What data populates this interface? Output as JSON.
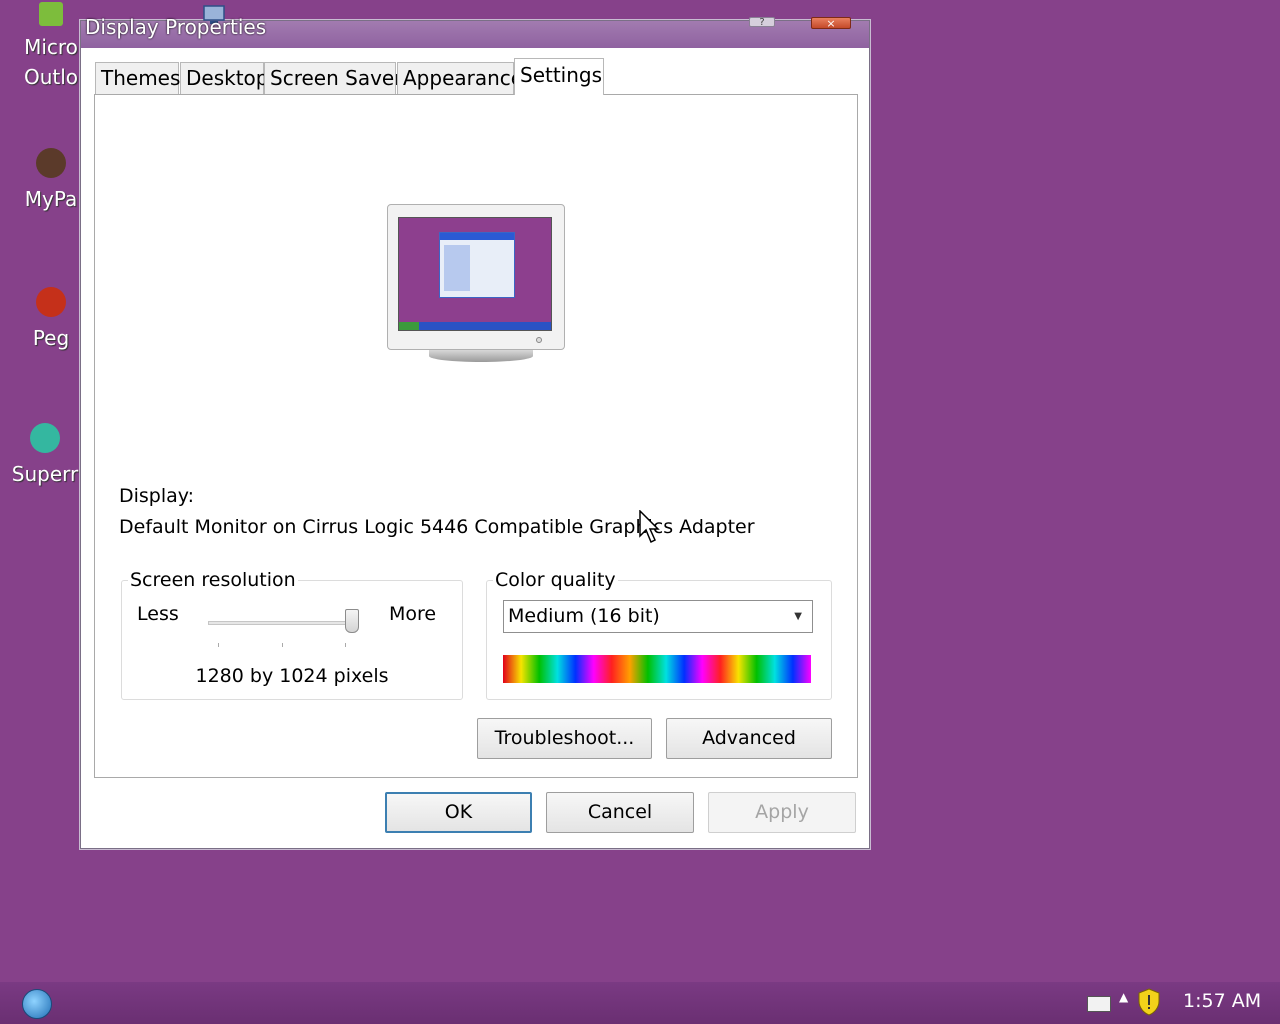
{
  "desktop": {
    "icons": [
      {
        "label": "Micro\nOutlo"
      },
      {
        "label": "MyPa"
      },
      {
        "label": "Peg"
      },
      {
        "label": "Superr"
      }
    ]
  },
  "window": {
    "title": "Display Properties",
    "help_label": "?",
    "close_label": "×"
  },
  "tabs": [
    {
      "label": "Themes"
    },
    {
      "label": "Desktop"
    },
    {
      "label": "Screen Saver"
    },
    {
      "label": "Appearance"
    },
    {
      "label": "Settings",
      "active": true
    }
  ],
  "settings": {
    "display_label": "Display:",
    "display_value": "Default Monitor on Cirrus Logic 5446 Compatible Graphics Adapter",
    "resolution": {
      "group_title": "Screen resolution",
      "less_label": "Less",
      "more_label": "More",
      "value_text": "1280 by 1024 pixels",
      "slider_position": 1.0
    },
    "color_quality": {
      "group_title": "Color quality",
      "selected": "Medium (16 bit)"
    },
    "troubleshoot_label": "Troubleshoot...",
    "advanced_label": "Advanced"
  },
  "footer": {
    "ok_label": "OK",
    "cancel_label": "Cancel",
    "apply_label": "Apply"
  },
  "taskbar": {
    "clock": "1:57 AM"
  },
  "colors": {
    "desktop_background": "#86418a",
    "title_bar": "#8f62a0",
    "default_button_border": "#3c7fb1"
  },
  "icons": [
    "start-orb-icon",
    "keyboard-icon",
    "security-shield-icon",
    "chevron-up-icon",
    "monitor-preview-icon",
    "mouse-cursor-icon"
  ]
}
